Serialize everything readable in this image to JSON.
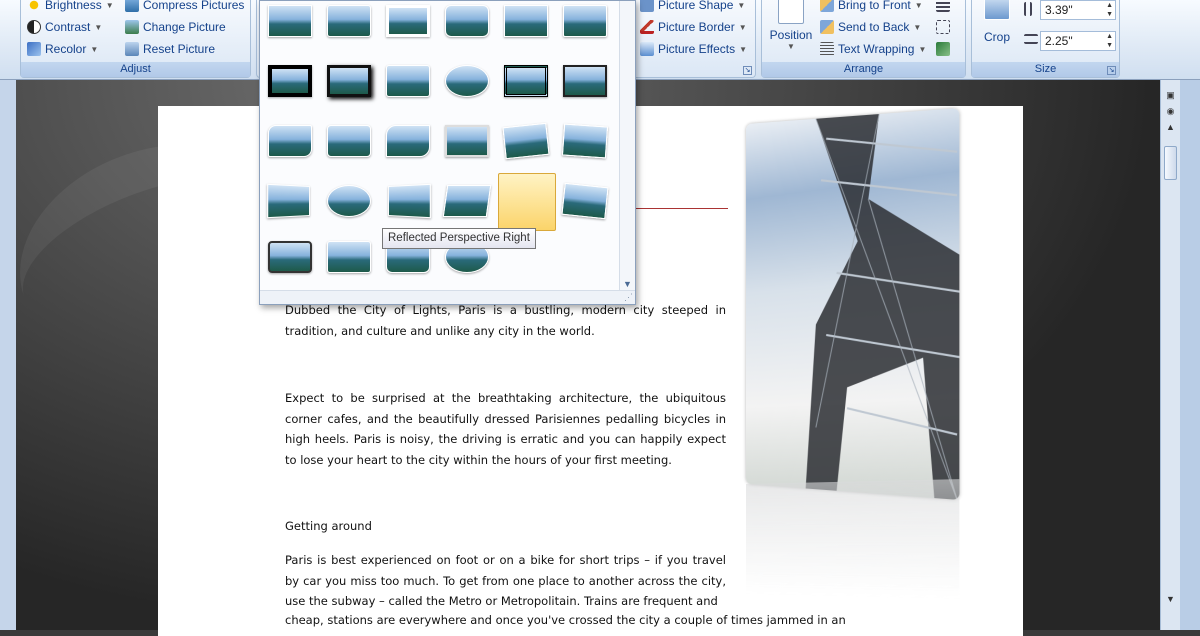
{
  "ribbon": {
    "adjust": {
      "label": "Adjust",
      "brightness": "Brightness",
      "contrast": "Contrast",
      "recolor": "Recolor",
      "compress": "Compress Pictures",
      "change": "Change Picture",
      "reset": "Reset Picture"
    },
    "picture_styles": {
      "shape": "Picture Shape",
      "border": "Picture Border",
      "effects": "Picture Effects"
    },
    "arrange": {
      "label": "Arrange",
      "position": "Position",
      "bring_front": "Bring to Front",
      "send_back": "Send to Back",
      "text_wrapping": "Text Wrapping"
    },
    "size": {
      "label": "Size",
      "crop": "Crop",
      "height": "3.39\"",
      "width": "2.25\""
    }
  },
  "gallery": {
    "tooltip": "Reflected Perspective Right",
    "selected_index": 22
  },
  "document": {
    "p1": "Dubbed the City of Lights, Paris is a bustling, modern city steeped in tradition, and culture and unlike any city in the world.",
    "p2": "Expect to be surprised at the breathtaking architecture, the ubiquitous corner cafes, and the beautifully dressed Parisiennes pedalling bicycles in high heels. Paris is noisy, the driving is erratic and you can happily expect to lose your heart to the city within the hours of your first meeting.",
    "heading": "Getting around",
    "p3a": "Paris is best experienced on foot or on a bike for short trips – if you travel by car you miss too much. To get from one place to another across the city, use the subway – called the Metro or Metropolitain. Trains are frequent and",
    "p3b": "cheap, stations are everywhere and once you've crossed the city a couple of times jammed in an"
  },
  "colors": {
    "ribbon_text": "#15428b",
    "selection": "#fbd46a"
  }
}
